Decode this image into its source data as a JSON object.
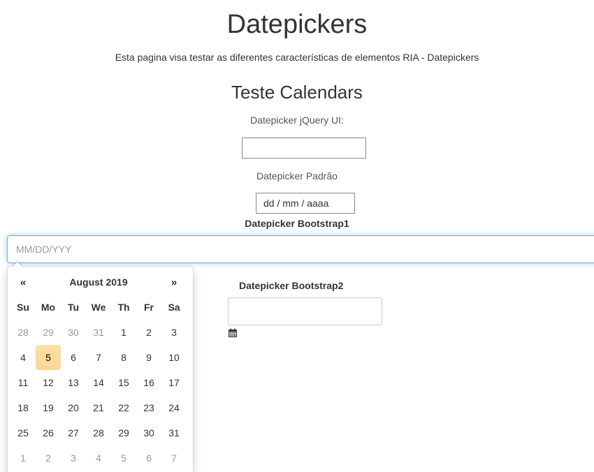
{
  "header": {
    "title": "Datepickers",
    "description": "Esta pagina visa testar as diferentes características de elementos RIA - Datepickers"
  },
  "section": {
    "title": "Teste Calendars"
  },
  "jquery_ui": {
    "label": "Datepicker jQuery UI:",
    "value": ""
  },
  "padrao": {
    "label": "Datepicker Padrão",
    "placeholder": "dd / mm / aaaa"
  },
  "bootstrap1": {
    "label": "Datepicker Bootstrap1",
    "placeholder": "MM/DD/YYY"
  },
  "calendar": {
    "prev": "«",
    "next": "»",
    "month_label": "August 2019",
    "weekdays": [
      "Su",
      "Mo",
      "Tu",
      "We",
      "Th",
      "Fr",
      "Sa"
    ],
    "weeks": [
      [
        {
          "d": "28",
          "m": true
        },
        {
          "d": "29",
          "m": true
        },
        {
          "d": "30",
          "m": true
        },
        {
          "d": "31",
          "m": true
        },
        {
          "d": "1"
        },
        {
          "d": "2"
        },
        {
          "d": "3"
        }
      ],
      [
        {
          "d": "4"
        },
        {
          "d": "5",
          "t": true
        },
        {
          "d": "6"
        },
        {
          "d": "7"
        },
        {
          "d": "8"
        },
        {
          "d": "9"
        },
        {
          "d": "10"
        }
      ],
      [
        {
          "d": "11"
        },
        {
          "d": "12"
        },
        {
          "d": "13"
        },
        {
          "d": "14"
        },
        {
          "d": "15"
        },
        {
          "d": "16"
        },
        {
          "d": "17"
        }
      ],
      [
        {
          "d": "18"
        },
        {
          "d": "19"
        },
        {
          "d": "20"
        },
        {
          "d": "21"
        },
        {
          "d": "22"
        },
        {
          "d": "23"
        },
        {
          "d": "24"
        }
      ],
      [
        {
          "d": "25"
        },
        {
          "d": "26"
        },
        {
          "d": "27"
        },
        {
          "d": "28"
        },
        {
          "d": "29"
        },
        {
          "d": "30"
        },
        {
          "d": "31"
        }
      ],
      [
        {
          "d": "1",
          "m": true
        },
        {
          "d": "2",
          "m": true
        },
        {
          "d": "3",
          "m": true
        },
        {
          "d": "4",
          "m": true
        },
        {
          "d": "5",
          "m": true
        },
        {
          "d": "6",
          "m": true
        },
        {
          "d": "7",
          "m": true
        }
      ]
    ],
    "today_color": "#fdd49a"
  },
  "bootstrap2": {
    "label": "Datepicker Bootstrap2",
    "value": "",
    "icon": "calendar-icon"
  },
  "colors": {
    "focus_border": "#66afe9",
    "muted_day": "#999999",
    "text": "#333333"
  }
}
